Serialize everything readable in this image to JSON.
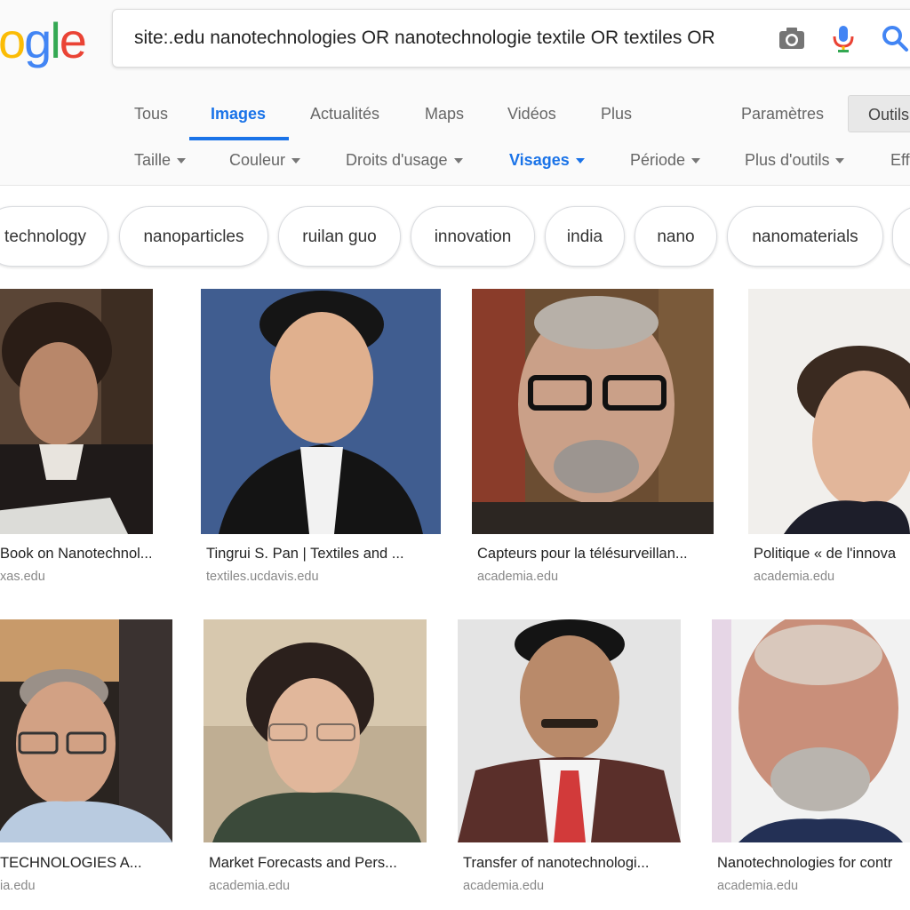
{
  "logo": {
    "visible_text": "ogle"
  },
  "search": {
    "query": "site:.edu nanotechnologies OR nanotechnologie textile OR textiles OR"
  },
  "nav": {
    "tabs": [
      {
        "label": "Tous"
      },
      {
        "label": "Images",
        "active": true
      },
      {
        "label": "Actualités"
      },
      {
        "label": "Maps"
      },
      {
        "label": "Vidéos"
      },
      {
        "label": "Plus"
      }
    ],
    "settings_label": "Paramètres",
    "tools_label": "Outils"
  },
  "filters": {
    "items": [
      {
        "label": "Taille"
      },
      {
        "label": "Couleur"
      },
      {
        "label": "Droits d'usage"
      },
      {
        "label": "Visages",
        "active": true
      },
      {
        "label": "Période"
      },
      {
        "label": "Plus d'outils"
      },
      {
        "label": "Eff"
      }
    ]
  },
  "chips": [
    {
      "label": "technology"
    },
    {
      "label": "nanoparticles"
    },
    {
      "label": "ruilan guo"
    },
    {
      "label": "innovation"
    },
    {
      "label": "india"
    },
    {
      "label": "nano"
    },
    {
      "label": "nanomaterials"
    }
  ],
  "results": [
    {
      "title": "Book on Nanotechnol...",
      "domain": "xas.edu"
    },
    {
      "title": "Tingrui S. Pan | Textiles and ...",
      "domain": "textiles.ucdavis.edu"
    },
    {
      "title": "Capteurs pour la télésurveillan...",
      "domain": "academia.edu"
    },
    {
      "title": "Politique « de l'innova",
      "domain": "academia.edu"
    },
    {
      "title": "TECHNOLOGIES A...",
      "domain": "ia.edu"
    },
    {
      "title": "Market Forecasts and Pers...",
      "domain": "academia.edu"
    },
    {
      "title": "Transfer of nanotechnologi...",
      "domain": "academia.edu"
    },
    {
      "title": "Nanotechnologies for contr",
      "domain": "academia.edu"
    }
  ],
  "colors": {
    "accent": "#1a73e8",
    "google_blue": "#4285f4",
    "google_red": "#ea4335",
    "google_yellow": "#fbbc05",
    "google_green": "#34a853"
  },
  "icons": [
    "camera-icon",
    "microphone-icon",
    "search-icon",
    "caret-down-icon"
  ]
}
